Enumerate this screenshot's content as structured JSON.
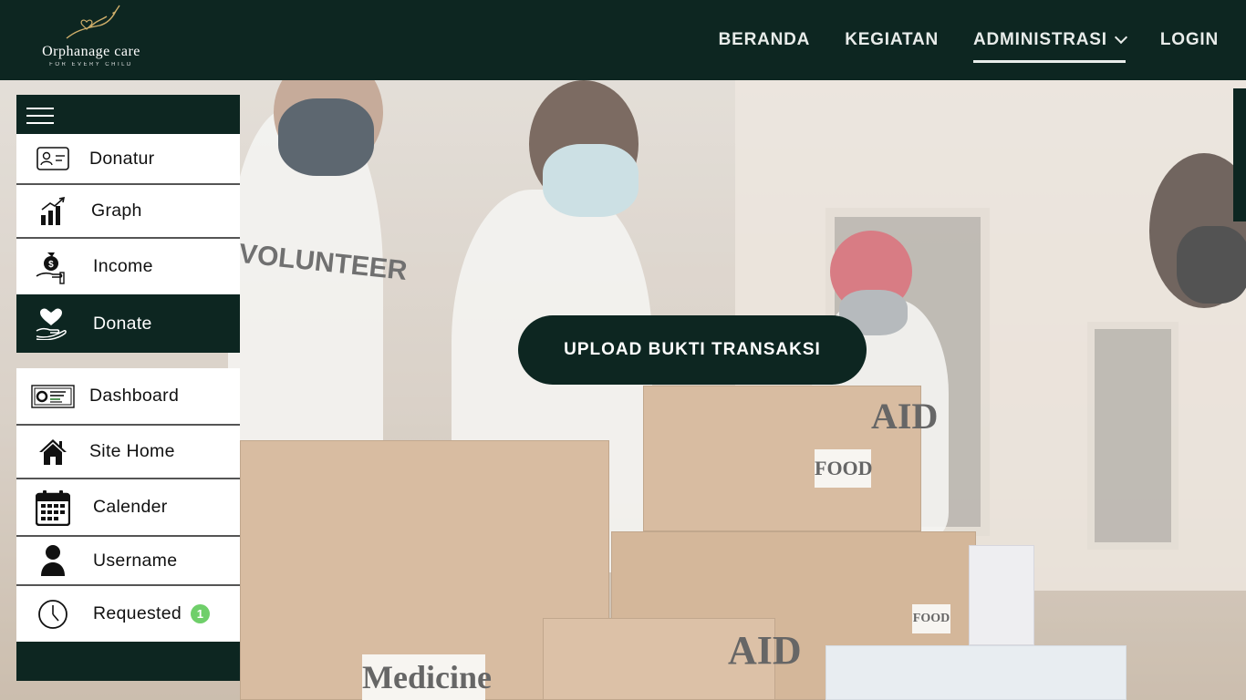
{
  "brand": {
    "name": "Orphanage care",
    "tagline": "FOR EVERY CHILD"
  },
  "nav": {
    "items": [
      {
        "label": "BERANDA"
      },
      {
        "label": "KEGIATAN"
      },
      {
        "label": "ADMINISTRASI"
      },
      {
        "label": "LOGIN"
      }
    ],
    "active": "ADMINISTRASI"
  },
  "sidebar": {
    "group1": [
      {
        "label": "Donatur",
        "icon": "id-card-icon"
      },
      {
        "label": "Graph",
        "icon": "bar-chart-icon"
      },
      {
        "label": "Income",
        "icon": "money-bag-hand-icon"
      },
      {
        "label": "Donate",
        "icon": "heart-hand-icon"
      }
    ],
    "group2": [
      {
        "label": "Dashboard",
        "icon": "dashboard-icon"
      },
      {
        "label": "Site Home",
        "icon": "house-icon"
      },
      {
        "label": "Calender",
        "icon": "calendar-icon"
      },
      {
        "label": "Username",
        "icon": "user-icon"
      },
      {
        "label": "Requested",
        "icon": "clock-icon",
        "badge": "1"
      }
    ]
  },
  "hero": {
    "cta_label": "UPLOAD BUKTI TRANSAKSI",
    "photo_texts": {
      "shirt": "VOLUNTEER",
      "box_aid": "AID",
      "box_food": "FOOD",
      "box_medicine": "Medicine",
      "box_aid2": "AID",
      "cup_food": "FOOD"
    }
  },
  "colors": {
    "primary": "#0d2621",
    "badge": "#6fcf6a",
    "background": "#ffffff"
  }
}
